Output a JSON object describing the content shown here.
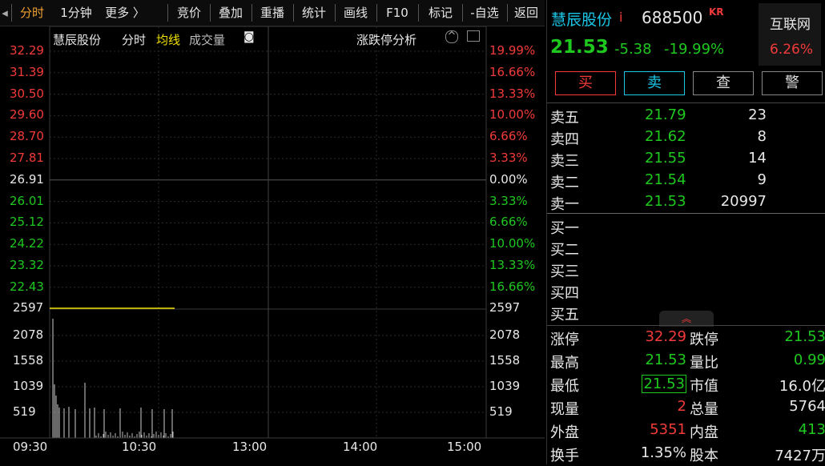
{
  "toolbar": {
    "items": [
      "分时",
      "1分钟",
      "更多 〉",
      "竞价",
      "叠加",
      "重播",
      "统计",
      "画线",
      "F10",
      "标记",
      "-自选",
      "返回"
    ]
  },
  "chart": {
    "stock_name": "慧辰股份",
    "mode_label": "分时",
    "avg_label": "均线",
    "vol_label": "成交量",
    "analysis_label": "涨跌停分析",
    "price_ticks": [
      "32.29",
      "31.39",
      "30.50",
      "29.60",
      "28.70",
      "27.81",
      "26.91",
      "26.01",
      "25.12",
      "24.22",
      "23.32",
      "22.43"
    ],
    "pct_ticks": [
      "19.99%",
      "16.66%",
      "13.33%",
      "10.00%",
      "6.66%",
      "3.33%",
      "0.00%",
      "3.33%",
      "6.66%",
      "10.00%",
      "13.33%",
      "16.66%"
    ],
    "vol_ticks": [
      "2597",
      "2078",
      "1558",
      "1039",
      "519"
    ],
    "time_ticks": [
      "09:30",
      "10:30",
      "13:00",
      "14:00",
      "15:00"
    ],
    "colors": {
      "up": "#f23a3a",
      "down": "#1ec81e",
      "flat": "#e8e8e8",
      "avg": "#f0e000"
    }
  },
  "quote": {
    "name": "慧辰股份",
    "info_icon": "i",
    "code": "688500",
    "tag": "KR",
    "sector": "互联网",
    "sector_pct": "6.26%",
    "price": "21.53",
    "change": "-5.38",
    "change_pct": "-19.99%",
    "buttons": [
      "买",
      "卖",
      "查",
      "警"
    ]
  },
  "orderbook": {
    "asks": [
      {
        "label": "卖五",
        "price": "21.79",
        "vol": "23"
      },
      {
        "label": "卖四",
        "price": "21.62",
        "vol": "8"
      },
      {
        "label": "卖三",
        "price": "21.55",
        "vol": "14"
      },
      {
        "label": "卖二",
        "price": "21.54",
        "vol": "9"
      },
      {
        "label": "卖一",
        "price": "21.53",
        "vol": "20997"
      }
    ],
    "bids": [
      {
        "label": "买一"
      },
      {
        "label": "买二"
      },
      {
        "label": "买三"
      },
      {
        "label": "买四"
      },
      {
        "label": "买五"
      }
    ]
  },
  "stats": {
    "rows": [
      {
        "l1": "涨停",
        "v1": "32.29",
        "l2": "跌停",
        "v2": "21.53"
      },
      {
        "l1": "最高",
        "v1": "21.53",
        "l2": "量比",
        "v2": "0.99"
      },
      {
        "l1": "最低",
        "v1": "21.53",
        "l2": "市值",
        "v2": "16.0亿"
      },
      {
        "l1": "现量",
        "v1": "2",
        "l2": "总量",
        "v2": "5764"
      },
      {
        "l1": "外盘",
        "v1": "5351",
        "l2": "内盘",
        "v2": "413"
      },
      {
        "l1": "换手",
        "v1": "1.35%",
        "l2": "股本",
        "v2": "7427万"
      }
    ]
  }
}
